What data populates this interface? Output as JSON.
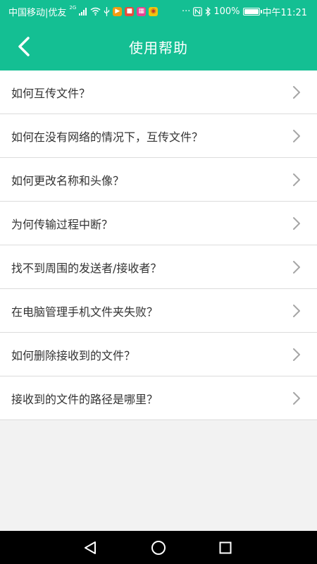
{
  "status_bar": {
    "carrier": "中国移动|优友",
    "network_type": "2G",
    "more_indicator": "···",
    "battery": "100%",
    "time": "中午11:21",
    "battery_level": 1.0
  },
  "header": {
    "title": "使用帮助",
    "background_color": "#14bf93"
  },
  "help_items": [
    {
      "label": "如何互传文件？"
    },
    {
      "label": "如何在没有网络的情况下，互传文件？"
    },
    {
      "label": "如何更改名称和头像？"
    },
    {
      "label": "为何传输过程中断？"
    },
    {
      "label": "找不到周围的发送者/接收者？"
    },
    {
      "label": "在电脑管理手机文件夹失败？"
    },
    {
      "label": "如何删除接收到的文件？"
    },
    {
      "label": "接收到的文件的路径是哪里？"
    }
  ],
  "icons": {
    "back": "back-arrow-icon",
    "chevron": "chevron-right-icon",
    "nav_back": "triangle-back-icon",
    "nav_home": "circle-home-icon",
    "nav_recent": "square-recent-icon"
  }
}
